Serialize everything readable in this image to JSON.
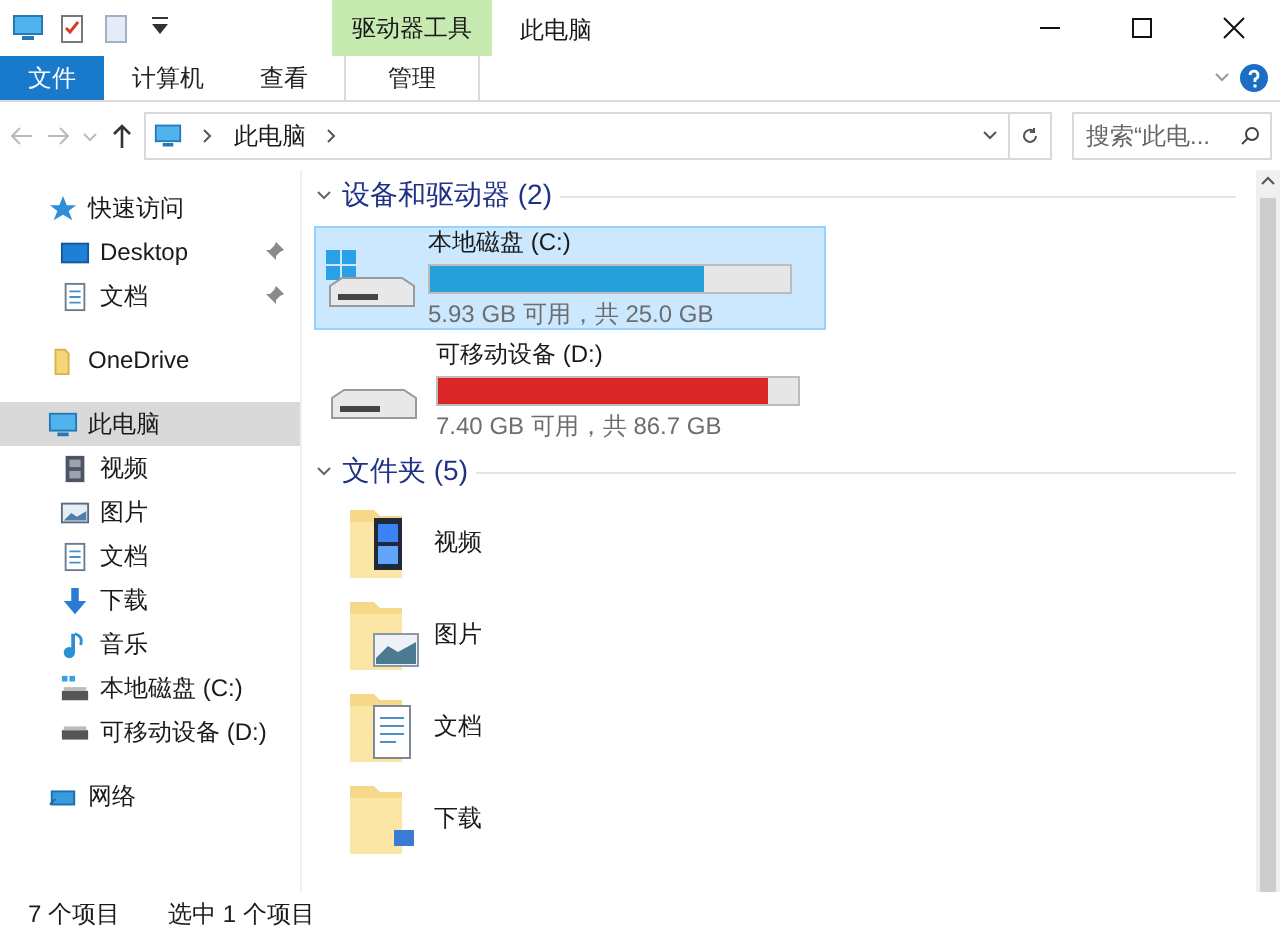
{
  "title_bar": {
    "context_tab": "驱动器工具",
    "title": "此电脑"
  },
  "ribbon": {
    "tabs": [
      {
        "label": "文件",
        "kind": "file"
      },
      {
        "label": "计算机",
        "kind": "normal"
      },
      {
        "label": "查看",
        "kind": "normal"
      },
      {
        "label": "管理",
        "kind": "context"
      }
    ]
  },
  "address_bar": {
    "breadcrumb": [
      "此电脑"
    ],
    "search": {
      "placeholder": "搜索“此电..."
    }
  },
  "sidebar": {
    "items": [
      {
        "label": "快速访问",
        "kind": "star",
        "selected": false,
        "children": [
          {
            "label": "Desktop",
            "kind": "desktop",
            "selected": false,
            "pinned": true
          },
          {
            "label": "文档",
            "kind": "document",
            "selected": false,
            "pinned": true
          }
        ]
      },
      {
        "label": "OneDrive",
        "kind": "folder",
        "selected": false
      },
      {
        "label": "此电脑",
        "kind": "computer",
        "selected": true,
        "children": [
          {
            "label": "视频",
            "kind": "video",
            "selected": false,
            "pinned": false
          },
          {
            "label": "图片",
            "kind": "picture",
            "selected": false,
            "pinned": false
          },
          {
            "label": "文档",
            "kind": "document",
            "selected": false,
            "pinned": false
          },
          {
            "label": "下载",
            "kind": "download",
            "selected": false,
            "pinned": false
          },
          {
            "label": "音乐",
            "kind": "music",
            "selected": false,
            "pinned": false
          },
          {
            "label": "本地磁盘 (C:)",
            "kind": "disk",
            "selected": false,
            "pinned": false
          },
          {
            "label": "可移动设备 (D:)",
            "kind": "removable",
            "selected": false,
            "pinned": false
          }
        ]
      },
      {
        "label": "网络",
        "kind": "network",
        "selected": false
      }
    ]
  },
  "devices": {
    "title": "设备和驱动器 (2)",
    "drives": [
      {
        "name": "本地磁盘 (C:)",
        "kind": "system",
        "selected": true,
        "level": 0.76,
        "color": "#26a0da",
        "space": "5.93 GB 可用，共 25.0 GB"
      },
      {
        "name": "可移动设备 (D:)",
        "kind": "removable",
        "selected": false,
        "level": 0.915,
        "color": "#da2626",
        "space": "7.40 GB 可用，共 86.7 GB"
      }
    ]
  },
  "folders": {
    "title": "文件夹 (5)",
    "items": [
      {
        "name": "视频",
        "kind": "video"
      },
      {
        "name": "图片",
        "kind": "picture"
      },
      {
        "name": "文档",
        "kind": "document"
      },
      {
        "name": "下载",
        "kind": "download"
      }
    ]
  },
  "status_bar": [
    "7 个项目",
    "选中 1 个项目"
  ]
}
